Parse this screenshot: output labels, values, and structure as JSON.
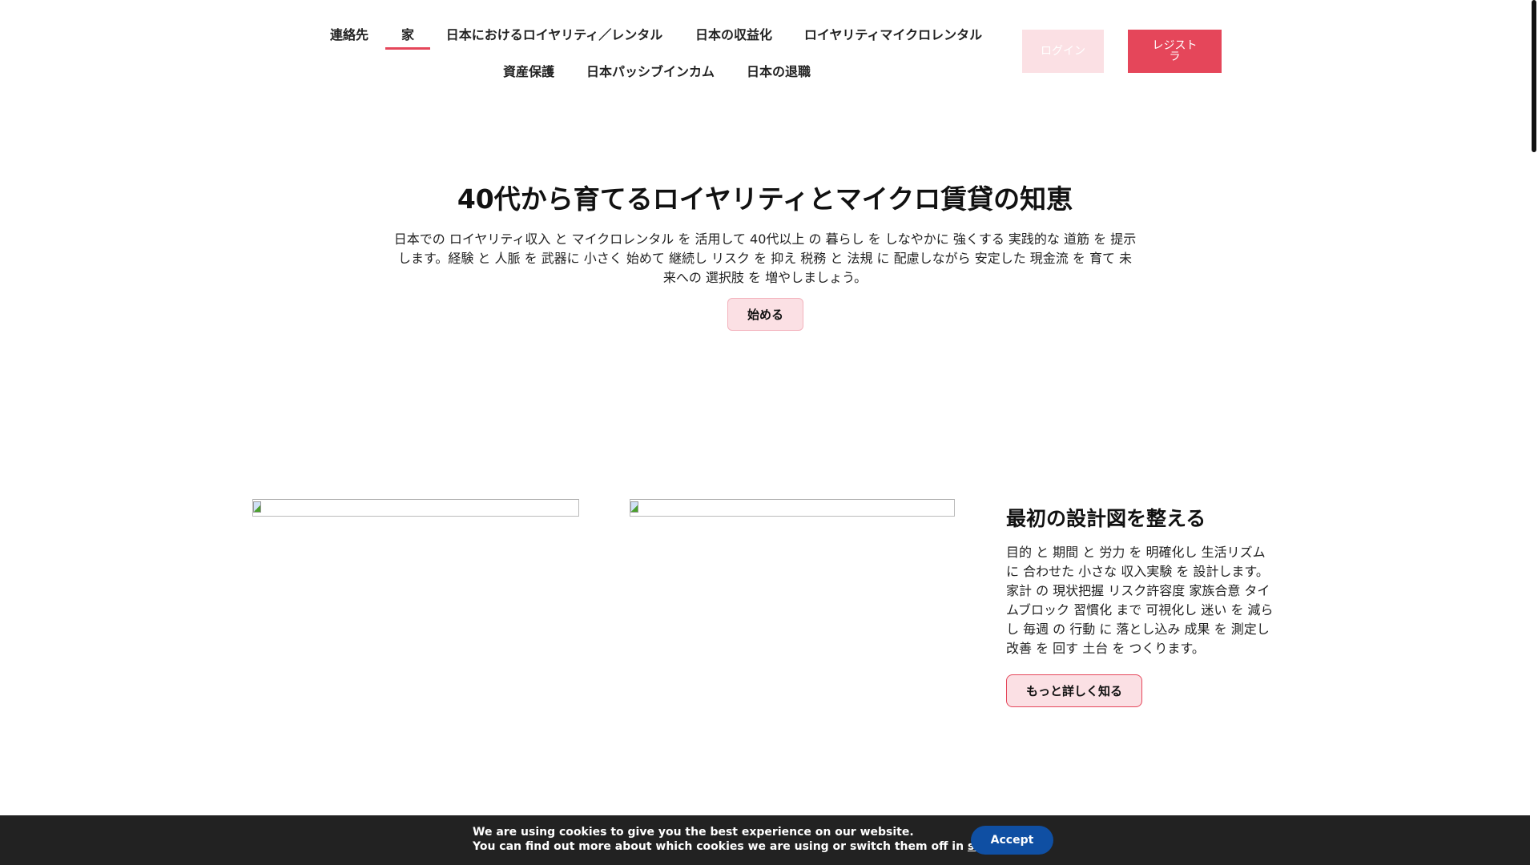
{
  "nav": {
    "row1": [
      "連絡先",
      "家",
      "日本におけるロイヤリティ／レンタル",
      "日本の収益化",
      "ロイヤリティマイクロレンタル"
    ],
    "row2": [
      "資産保護",
      "日本パッシブインカム",
      "日本の退職"
    ],
    "active": "家",
    "login": "ログイン",
    "register": "レジストラ"
  },
  "hero": {
    "title": "40代から育てるロイヤリティとマイクロ賃貸の知恵",
    "text": "日本での ロイヤリティ収入 と マイクロレンタル を 活用して 40代以上 の 暮らし を しなやかに 強くする 実践的な 道筋 を 提示します。経験 と 人脈 を 武器に 小さく 始めて 継続し リスク を 抑え 税務 と 法規 に 配慮しながら 安定した 現金流 を 育て 未来への 選択肢 を 増やしましょう。",
    "cta": "始める"
  },
  "feature": {
    "title": "最初の設計図を整える",
    "text": "目的 と 期間 と 労力 を 明確化し 生活リズム に 合わせた 小さな 収入実験 を 設計します。家計 の 現状把握 リスク許容度 家族合意 タイムブロック 習慣化 まで 可視化し 迷い を 減らし 毎週 の 行動 に 落とし込み 成果 を 測定し 改善 を 回す 土台 を つくります。",
    "cta": "もっと詳しく知る"
  },
  "cookie": {
    "line1": "We are using cookies to give you the best experience on our website.",
    "line2": "You can find out more about which cookies we are using or switch them off in ",
    "link": "settings",
    "period": ".",
    "accept": "Accept"
  },
  "colors": {
    "accent": "#e5465a",
    "accent_light": "#fbe0e4",
    "cookie_bg": "#222222",
    "accept": "#0f4fa3"
  }
}
